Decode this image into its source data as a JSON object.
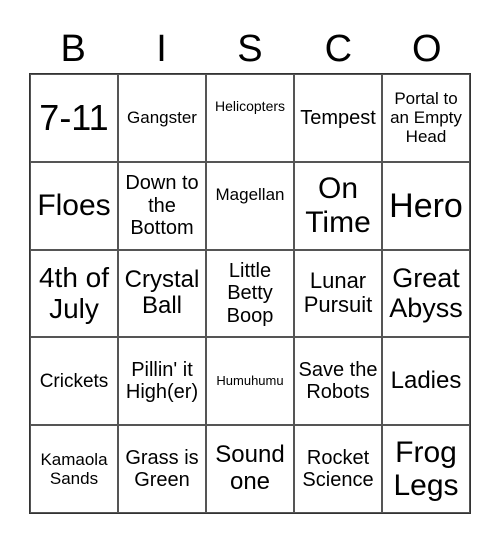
{
  "header": [
    "B",
    "I",
    "S",
    "C",
    "O"
  ],
  "cells": [
    "7-11",
    "Gangster",
    "Helicopters",
    "Tempest",
    "Portal to an Empty Head",
    "Floes",
    "Down to the Bottom",
    "Magellan",
    "On Time",
    "Hero",
    "4th of July",
    "Crystal Ball",
    "Little Betty Boop",
    "Lunar Pursuit",
    "Great Abyss",
    "Crickets",
    "Pillin' it High(er)",
    "Humuhumu",
    "Save the Robots",
    "Ladies",
    "Kamaola Sands",
    "Grass is Green",
    "Sound one",
    "Rocket Science",
    "Frog Legs"
  ]
}
